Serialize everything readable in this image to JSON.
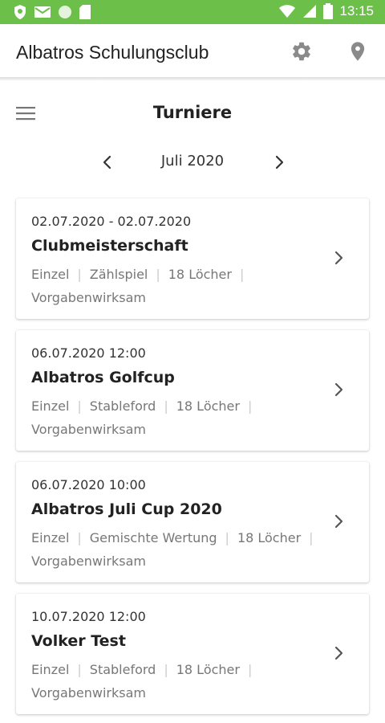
{
  "status_bar": {
    "time": "13:15",
    "icons": [
      "shield-icon",
      "mail-icon",
      "circle-icon",
      "sd-card-icon",
      "wifi-icon",
      "signal-icon",
      "battery-icon"
    ],
    "color": "#6cc04a"
  },
  "app_bar": {
    "title": "Albatros Schulungsclub",
    "actions": [
      "gear-icon",
      "location-pin-icon"
    ]
  },
  "page": {
    "title": "Turniere",
    "menu_icon": "hamburger-menu-icon"
  },
  "month_nav": {
    "label": "Juli 2020",
    "prev_icon": "chevron-left-icon",
    "next_icon": "chevron-right-icon"
  },
  "tournaments": [
    {
      "date": "02.07.2020 - 02.07.2020",
      "name": "Clubmeisterschaft",
      "tags": [
        "Einzel",
        "Zählspiel",
        "18 Löcher"
      ],
      "extra": "Vorgabenwirksam"
    },
    {
      "date": "06.07.2020 12:00",
      "name": "Albatros Golfcup",
      "tags": [
        "Einzel",
        "Stableford",
        "18 Löcher"
      ],
      "extra": "Vorgabenwirksam"
    },
    {
      "date": "06.07.2020 10:00",
      "name": "Albatros Juli Cup 2020",
      "tags": [
        "Einzel",
        "Gemischte Wertung",
        "18 Löcher"
      ],
      "extra": "Vorgabenwirksam"
    },
    {
      "date": "10.07.2020 12:00",
      "name": "Volker Test",
      "tags": [
        "Einzel",
        "Stableford",
        "18 Löcher"
      ],
      "extra": "Vorgabenwirksam"
    }
  ]
}
